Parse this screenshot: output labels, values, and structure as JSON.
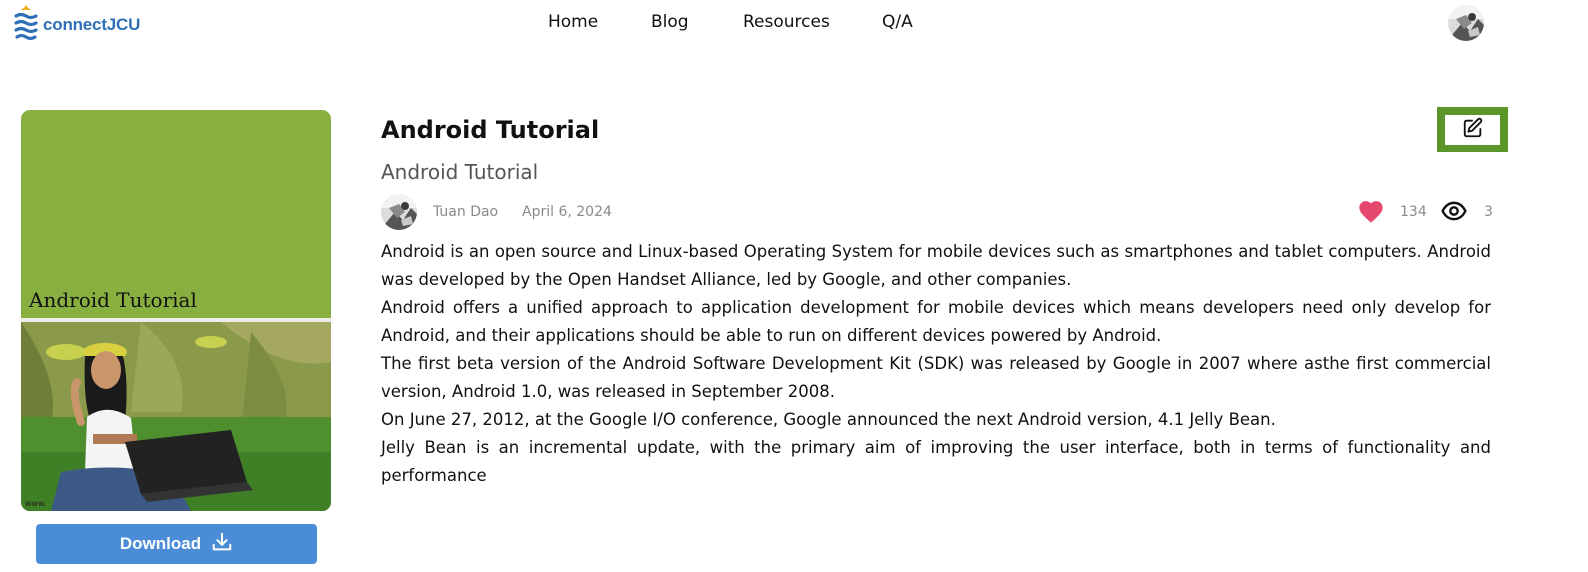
{
  "brand": {
    "name": "connectJCU",
    "color": "#2f6fb8"
  },
  "nav": {
    "home": "Home",
    "blog": "Blog",
    "resources": "Resources",
    "qa": "Q/A"
  },
  "cover": {
    "title": "Android Tutorial",
    "background": "#87b040"
  },
  "download": {
    "label": "Download",
    "color": "#4a8dd6"
  },
  "post": {
    "title": "Android Tutorial",
    "subtitle": "Android Tutorial",
    "author": "Tuan Dao",
    "date": "April 6, 2024",
    "likes": "134",
    "views": "3",
    "edit_color": "#5a962a",
    "paragraphs": [
      "Android is an open source and Linux-based Operating System for mobile devices such as smartphones and tablet computers. Android was developed by the Open Handset Alliance, led by Google, and other companies.",
      "Android offers a unified approach to application development for mobile devices which means developers need only develop for Android, and their applications should be able to run on different devices powered by Android.",
      "The first beta version of the Android Software Development Kit (SDK) was released by Google in 2007 where asthe first commercial version, Android 1.0, was released in September 2008.",
      "On June 27, 2012, at the Google I/O conference, Google announced the next Android version, 4.1 Jelly Bean.",
      "Jelly Bean is an incremental update, with the primary aim of improving the user interface, both in terms of functionality and performance"
    ]
  },
  "icons": {
    "logo": "jcu-crest-icon",
    "edit": "pencil-edit-icon",
    "download": "download-icon",
    "like": "heart-icon",
    "views": "eye-icon"
  }
}
